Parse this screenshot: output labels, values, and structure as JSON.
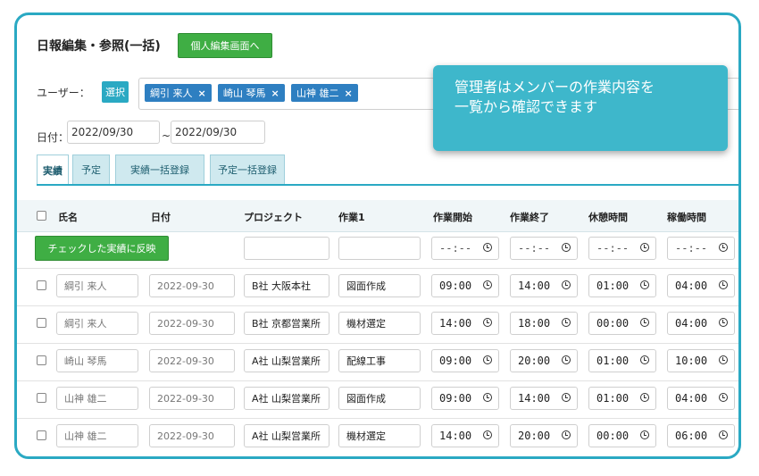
{
  "title": "日報編集・参照(一括)",
  "personal_button": "個人編集画面へ",
  "user_label": "ユーザー：",
  "select_button": "選択",
  "users": [
    {
      "name": "綱引 来人",
      "remove": "×"
    },
    {
      "name": "崎山 琴馬",
      "remove": "×"
    },
    {
      "name": "山神 雄二",
      "remove": "×"
    }
  ],
  "date_label": "日付：",
  "date_from": "2022/09/30",
  "date_sep": "~",
  "date_to": "2022/09/30",
  "tabs": [
    "実績",
    "予定",
    "実績一括登録",
    "予定一括登録"
  ],
  "columns": [
    "氏名",
    "日付",
    "プロジェクト",
    "作業1",
    "作業開始",
    "作業終了",
    "休憩時間",
    "稼働時間"
  ],
  "apply_button": "チェックした実績に反映",
  "time_placeholder": "--:--",
  "rows": [
    {
      "name": "綱引 来人",
      "date": "2022-09-30",
      "project": "B社 大阪本社",
      "task": "図面作成",
      "start": "09:00",
      "end": "14:00",
      "break": "01:00",
      "work": "04:00"
    },
    {
      "name": "綱引 来人",
      "date": "2022-09-30",
      "project": "B社 京都営業所",
      "task": "機材選定",
      "start": "14:00",
      "end": "18:00",
      "break": "00:00",
      "work": "04:00"
    },
    {
      "name": "崎山 琴馬",
      "date": "2022-09-30",
      "project": "A社 山梨営業所",
      "task": "配線工事",
      "start": "09:00",
      "end": "20:00",
      "break": "01:00",
      "work": "10:00"
    },
    {
      "name": "山神 雄二",
      "date": "2022-09-30",
      "project": "A社 山梨営業所",
      "task": "図面作成",
      "start": "09:00",
      "end": "14:00",
      "break": "01:00",
      "work": "04:00"
    },
    {
      "name": "山神 雄二",
      "date": "2022-09-30",
      "project": "A社 山梨営業所",
      "task": "機材選定",
      "start": "14:00",
      "end": "20:00",
      "break": "00:00",
      "work": "06:00"
    }
  ],
  "callout": {
    "line1": "管理者はメンバーの作業内容を",
    "line2": "一覧から確認できます"
  },
  "colors": {
    "accent": "#2aa9c3",
    "green": "#3fae44",
    "chip": "#2e7fc1",
    "callout": "#3eb7cb"
  }
}
